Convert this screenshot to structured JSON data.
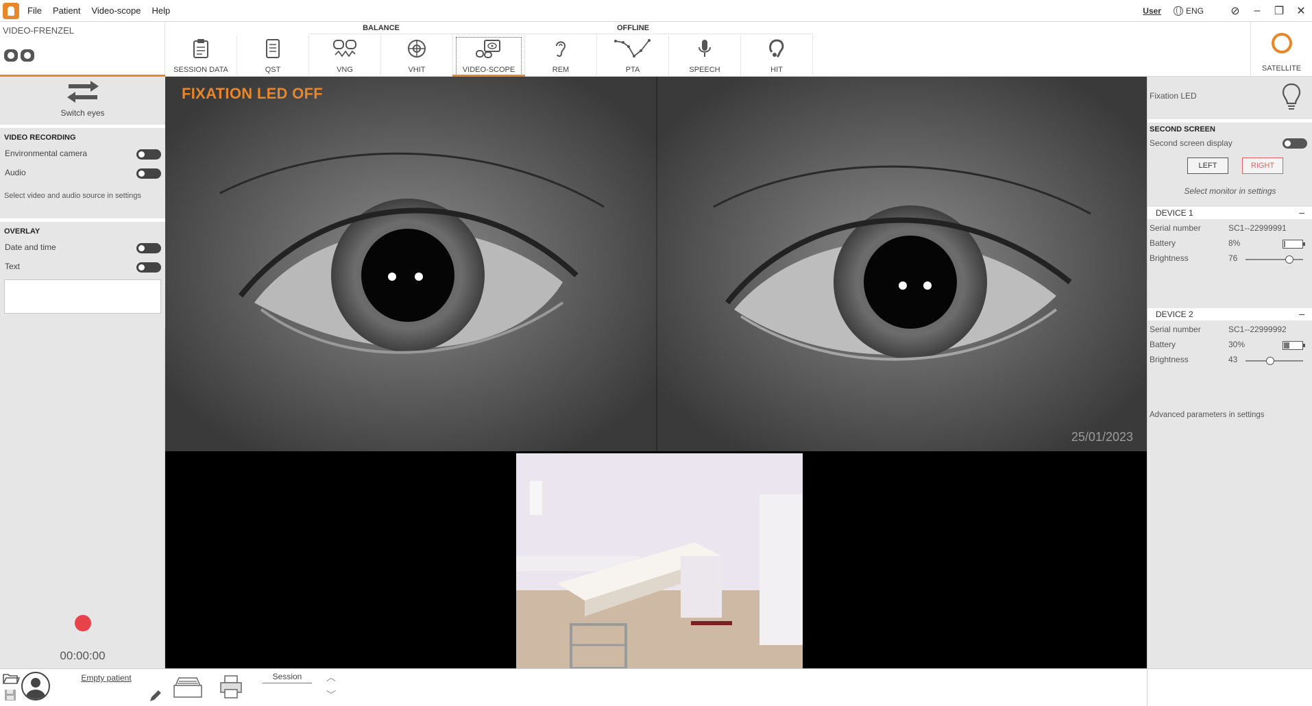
{
  "menu": {
    "items": [
      "File",
      "Patient",
      "Video-scope",
      "Help"
    ],
    "user": "User",
    "language": "ENG"
  },
  "module": {
    "title": "VIDEO-FRENZEL"
  },
  "toolbar": {
    "groups": {
      "balance": "BALANCE",
      "offline": "OFFLINE"
    },
    "buttons": [
      "SESSION DATA",
      "QST",
      "VNG",
      "VHIT",
      "VIDEO-SCOPE",
      "REM",
      "PTA",
      "SPEECH",
      "HIT"
    ],
    "satellite": "SATELLITE"
  },
  "left": {
    "switch_eyes": "Switch eyes",
    "video_recording": {
      "title": "VIDEO RECORDING",
      "env_camera": "Environmental camera",
      "audio": "Audio",
      "note": "Select video and audio source in settings"
    },
    "overlay": {
      "title": "OVERLAY",
      "date_time": "Date and time",
      "text": "Text"
    },
    "timer": "00:00:00",
    "patient": "Empty patient"
  },
  "video": {
    "fixation_label": "FIXATION LED OFF",
    "date_stamp": "25/01/2023"
  },
  "bottom": {
    "session": "Session"
  },
  "right": {
    "fixation_led": "Fixation LED",
    "second_screen": {
      "title": "SECOND SCREEN",
      "display": "Second screen display",
      "left": "LEFT",
      "right": "RIGHT",
      "note": "Select monitor in settings"
    },
    "device1": {
      "title": "DEVICE 1",
      "serial_label": "Serial number",
      "serial": "SC1--22999991",
      "battery_label": "Battery",
      "battery": "8%",
      "battery_fraction": 0.08,
      "brightness_label": "Brightness",
      "brightness": "76",
      "brightness_value": 76
    },
    "device2": {
      "title": "DEVICE 2",
      "serial_label": "Serial number",
      "serial": "SC1--22999992",
      "battery_label": "Battery",
      "battery": "30%",
      "battery_fraction": 0.3,
      "brightness_label": "Brightness",
      "brightness": "43",
      "brightness_value": 43
    },
    "advanced_note": "Advanced parameters in settings"
  },
  "colors": {
    "accent": "#e8862a",
    "record": "#e8424a",
    "right_button": "#e06060"
  }
}
